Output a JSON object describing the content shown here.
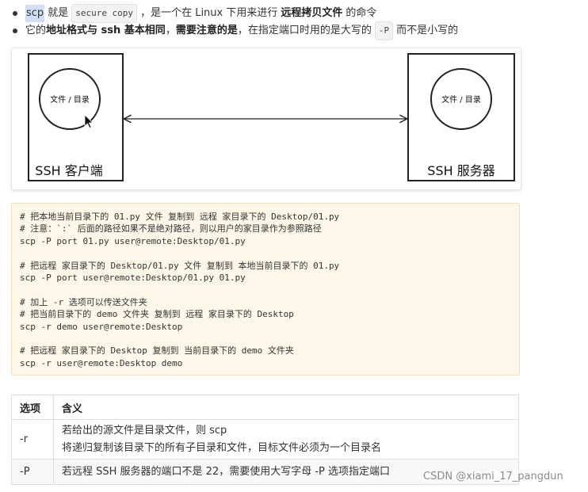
{
  "bullets": [
    {
      "term": "scp",
      "t1": "就是",
      "code": "secure copy",
      "t2": "，是一个在 Linux 下用来进行",
      "bold": "远程拷贝文件",
      "t3": "的命令"
    },
    {
      "t1": "它的",
      "bold1": "地址格式与 ssh 基本相同",
      "t2": "，",
      "bold2": "需要注意的是",
      "t3": "，在指定端口时用的是大写的",
      "code": "-P",
      "t4": "而不是小写的"
    }
  ],
  "diagram": {
    "left_box": {
      "circle_label": "文件 / 目录",
      "label": "SSH 客户端"
    },
    "right_box": {
      "circle_label": "文件 / 目录",
      "label": "SSH 服务器"
    }
  },
  "code_lines": [
    "# 把本地当前目录下的 01.py 文件 复制到 远程 家目录下的 Desktop/01.py",
    "# 注意：`:` 后面的路径如果不是绝对路径，则以用户的家目录作为参照路径",
    "scp -P port 01.py user@remote:Desktop/01.py",
    "",
    "# 把远程 家目录下的 Desktop/01.py 文件 复制到 本地当前目录下的 01.py",
    "scp -P port user@remote:Desktop/01.py 01.py",
    "",
    "# 加上 -r 选项可以传送文件夹",
    "# 把当前目录下的 demo 文件夹 复制到 远程 家目录下的 Desktop",
    "scp -r demo user@remote:Desktop",
    "",
    "# 把远程 家目录下的 Desktop 复制到 当前目录下的 demo 文件夹",
    "scp -r user@remote:Desktop demo"
  ],
  "table": {
    "headers": [
      "选项",
      "含义"
    ],
    "rows": [
      {
        "option": "-r",
        "lines": [
          "若给出的源文件是目录文件，则 scp",
          "将递归复制该目录下的所有子目录和文件，目标文件必须为一个目录名"
        ]
      },
      {
        "option": "-P",
        "lines": [
          "若远程 SSH 服务器的端口不是 22，需要使用大写字母 -P 选项指定端口"
        ]
      }
    ]
  },
  "watermark": "CSDN @xiami_17_pangdun"
}
